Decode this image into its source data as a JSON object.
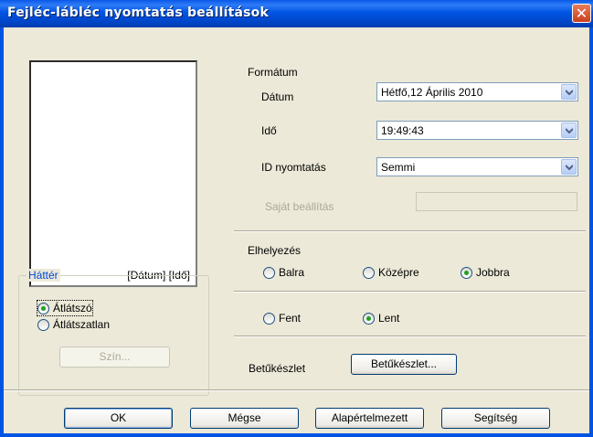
{
  "window": {
    "title": "Fejléc-lábléc nyomtatás beállítások",
    "close_glyph": "✕"
  },
  "preview": {
    "label": "[Dátum] [Idő]"
  },
  "background": {
    "legend": "Háttér",
    "options": [
      {
        "label": "Átlátszó",
        "selected": true
      },
      {
        "label": "Átlátszatlan",
        "selected": false
      }
    ],
    "color_button": "Szín..."
  },
  "format": {
    "heading": "Formátum",
    "date": {
      "label": "Dátum",
      "value": "Hétfő,12 Április 2010"
    },
    "time": {
      "label": "Idő",
      "value": "19:49:43"
    },
    "id_print": {
      "label": "ID nyomtatás",
      "value": "Semmi"
    },
    "custom": {
      "label": "Saját beállítás",
      "value": ""
    }
  },
  "placement": {
    "heading": "Elhelyezés",
    "horizontal": [
      {
        "label": "Balra",
        "selected": false
      },
      {
        "label": "Középre",
        "selected": false
      },
      {
        "label": "Jobbra",
        "selected": true
      }
    ],
    "vertical": [
      {
        "label": "Fent",
        "selected": false
      },
      {
        "label": "Lent",
        "selected": true
      }
    ]
  },
  "font": {
    "label": "Betűkészlet",
    "button": "Betűkészlet..."
  },
  "footer": {
    "ok": "OK",
    "cancel": "Mégse",
    "default": "Alapértelmezett",
    "help": "Segítség"
  },
  "colors": {
    "accent": "#0054e3",
    "legend": "#0046d5",
    "radio_on": "#21a121"
  }
}
